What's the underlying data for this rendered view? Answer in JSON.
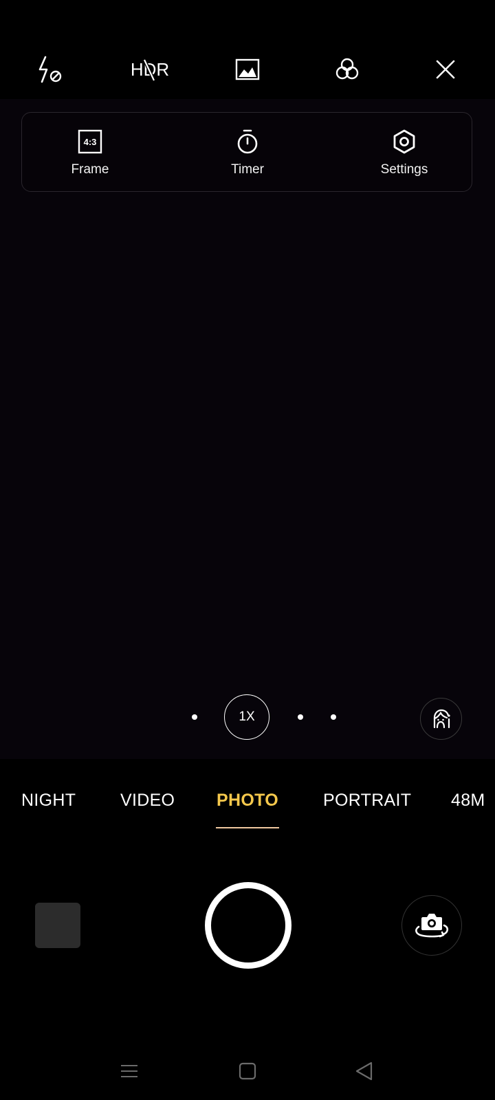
{
  "toolbar": {
    "hdr_label": "HDR",
    "icons": [
      "flash-off-icon",
      "hdr-off-icon",
      "gallery-image-icon",
      "filter-icon",
      "close-icon"
    ]
  },
  "quick_panel": {
    "items": [
      {
        "label": "Frame",
        "icon": "aspect-ratio-icon",
        "icon_text": "4:3"
      },
      {
        "label": "Timer",
        "icon": "timer-icon"
      },
      {
        "label": "Settings",
        "icon": "settings-icon"
      }
    ]
  },
  "zoom": {
    "current_label": "1X"
  },
  "modes": {
    "items": [
      "NIGHT",
      "VIDEO",
      "PHOTO",
      "PORTRAIT",
      "48M"
    ],
    "active": "PHOTO"
  },
  "colors": {
    "active_mode": "#f5c84c",
    "underline": "#f0c9a0",
    "viewfinder_bg": "#07040a"
  },
  "system_nav": {
    "icons": [
      "menu-icon",
      "home-icon",
      "back-icon"
    ]
  }
}
